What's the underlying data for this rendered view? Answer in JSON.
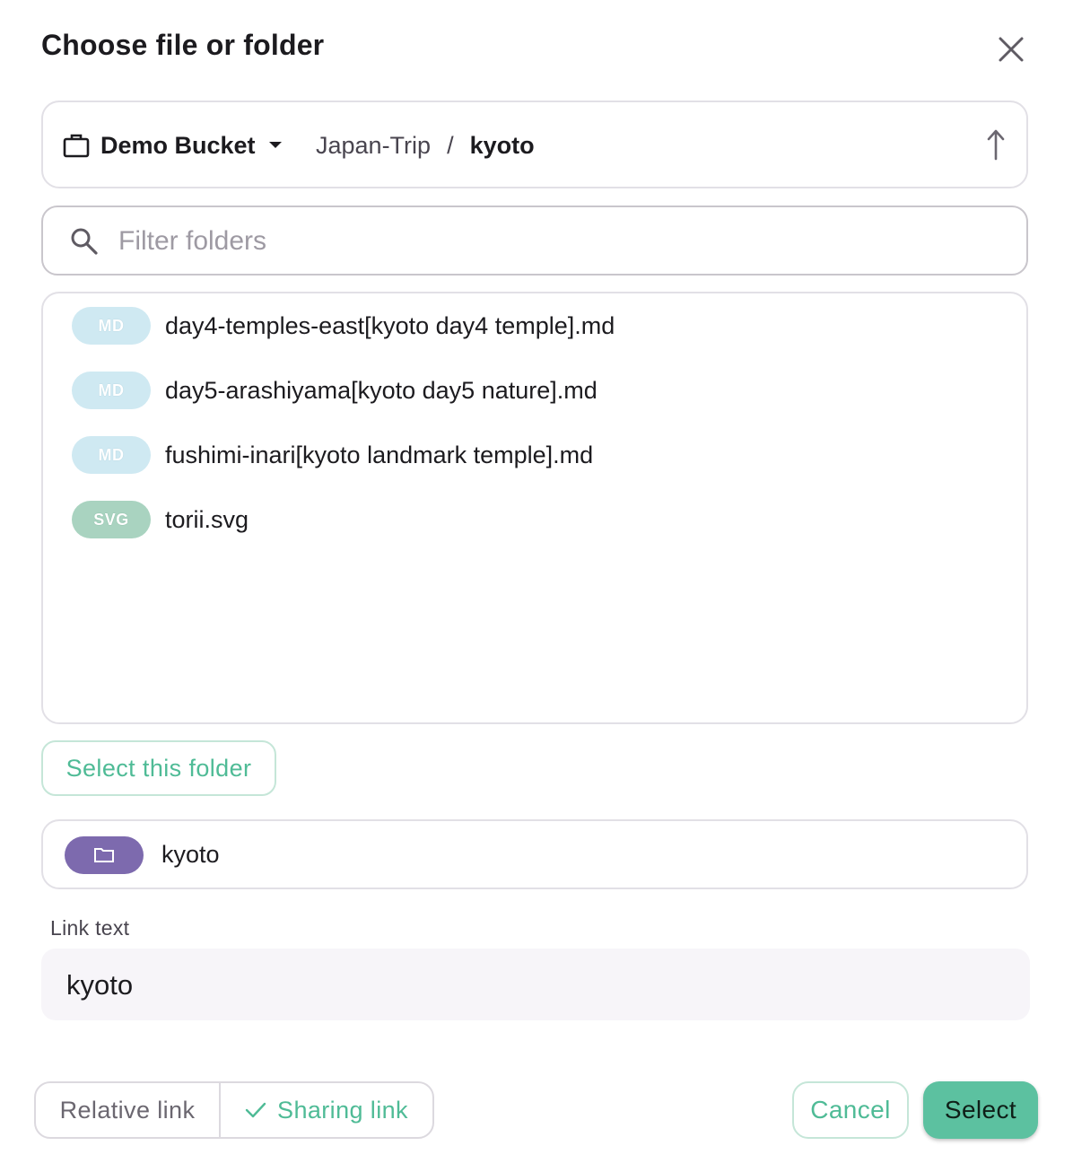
{
  "dialog": {
    "title": "Choose file or folder",
    "close_icon": "close-icon"
  },
  "breadcrumb": {
    "bucket_label": "Demo Bucket",
    "bucket_icon": "briefcase-icon",
    "path": [
      "Japan-Trip",
      "kyoto"
    ],
    "separator": "/",
    "up_icon": "arrow-up-icon"
  },
  "filter": {
    "placeholder": "Filter folders",
    "value": "",
    "icon": "search-icon"
  },
  "files": [
    {
      "type": "MD",
      "name": "day4-temples-east[kyoto day4 temple].md"
    },
    {
      "type": "MD",
      "name": "day5-arashiyama[kyoto day5 nature].md"
    },
    {
      "type": "MD",
      "name": "fushimi-inari[kyoto landmark temple].md"
    },
    {
      "type": "SVG",
      "name": "torii.svg"
    }
  ],
  "select_folder_label": "Select this folder",
  "selected": {
    "icon": "folder-icon",
    "name": "kyoto"
  },
  "link_text": {
    "label": "Link text",
    "value": "kyoto"
  },
  "link_type": {
    "relative_label": "Relative link",
    "sharing_label": "Sharing link",
    "selected": "Sharing link"
  },
  "actions": {
    "cancel_label": "Cancel",
    "select_label": "Select"
  },
  "colors": {
    "accent": "#4fbb96",
    "primary_button": "#5cc1a0",
    "md_badge": "#cfe9f2",
    "svg_badge": "#a9d3c0",
    "folder_chip": "#7d6aae"
  }
}
